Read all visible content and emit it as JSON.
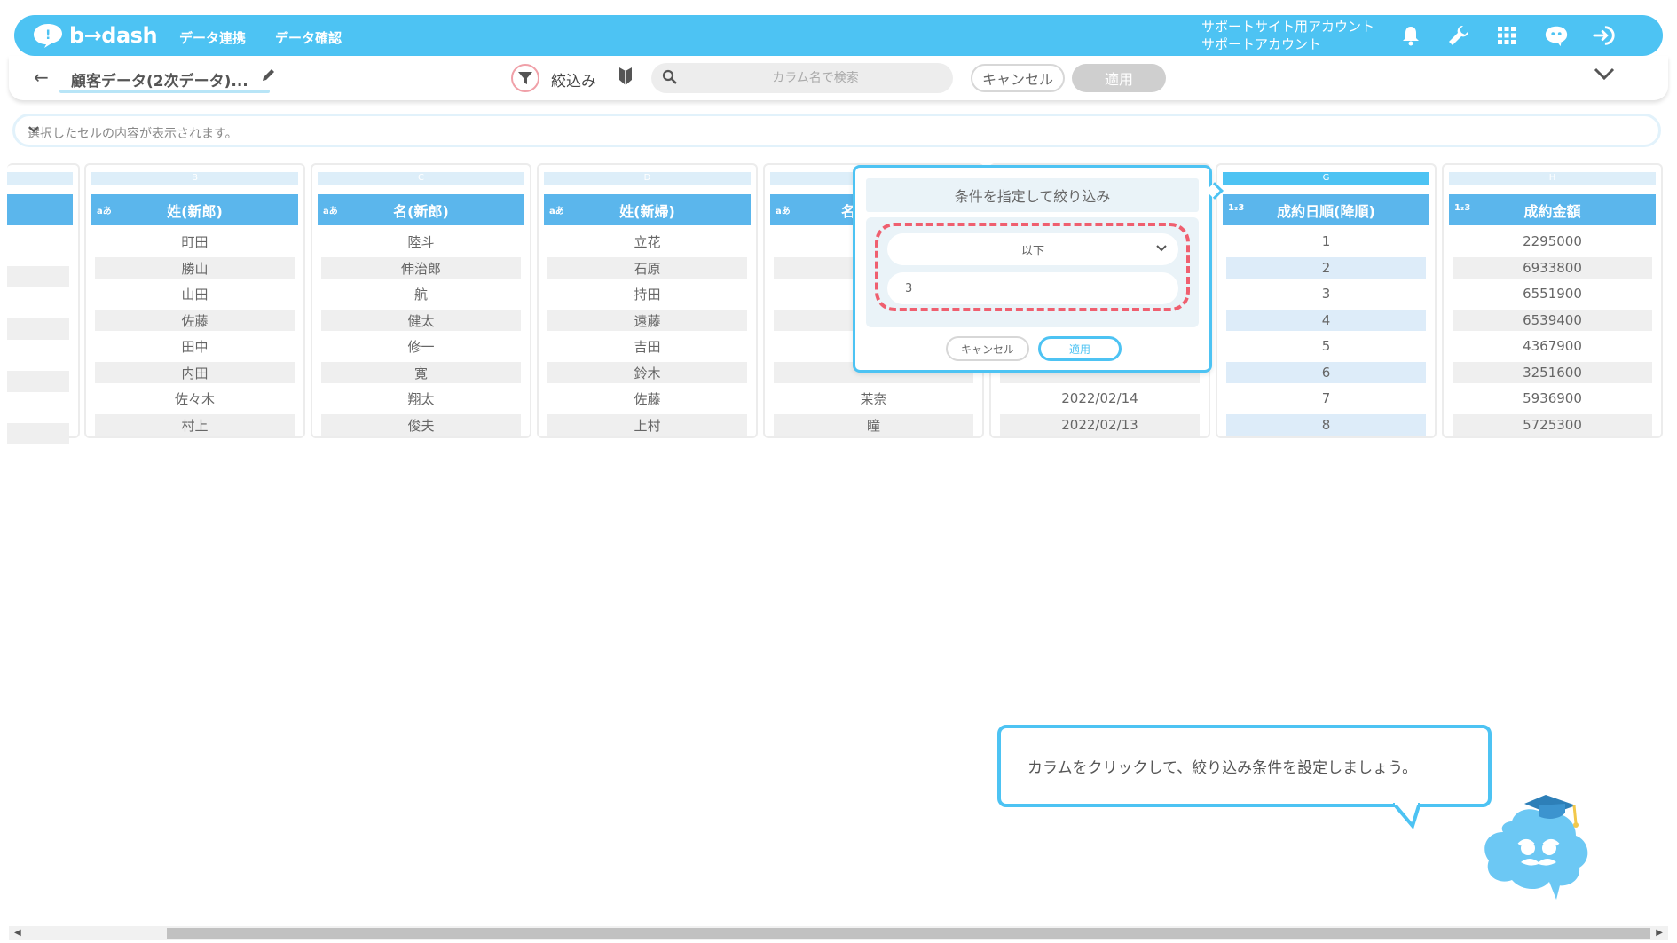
{
  "app": {
    "logo_text": "b→dash"
  },
  "nav": {
    "link1": "データ連携",
    "link2": "データ確認"
  },
  "account": {
    "line1": "サポートサイト用アカウント",
    "line2": "サポートアカウント"
  },
  "toolbar": {
    "table_name": "顧客データ(2次データ)...",
    "filter_label": "絞込み",
    "search_placeholder": "カラム名で検索",
    "cancel_label": "キャンセル",
    "apply_label": "適用"
  },
  "cellbar": {
    "placeholder": "選択したセルの内容が表示されます。"
  },
  "columns": {
    "B": {
      "letter": "B",
      "type": "aあ",
      "header": "姓(新郎)",
      "values": [
        "町田",
        "勝山",
        "山田",
        "佐藤",
        "田中",
        "内田",
        "佐々木",
        "村上"
      ]
    },
    "C": {
      "letter": "C",
      "type": "aあ",
      "header": "名(新郎)",
      "values": [
        "陸斗",
        "伸治郎",
        "航",
        "健太",
        "修一",
        "寛",
        "翔太",
        "俊夫"
      ]
    },
    "D": {
      "letter": "D",
      "type": "aあ",
      "header": "姓(新婦)",
      "values": [
        "立花",
        "石原",
        "持田",
        "遠藤",
        "吉田",
        "鈴木",
        "佐藤",
        "上村"
      ]
    },
    "E": {
      "type": "aあ",
      "header": "名",
      "values": [
        "茉奈",
        "瞳"
      ]
    },
    "F": {
      "values": [
        "2022/02/14",
        "2022/02/13"
      ]
    },
    "G": {
      "letter": "G",
      "type": "1₂3",
      "header": "成約日順(降順)",
      "values": [
        "1",
        "2",
        "3",
        "4",
        "5",
        "6",
        "7",
        "8"
      ]
    },
    "H": {
      "letter": "H",
      "type": "1₂3",
      "header": "成約金額",
      "values": [
        "2295000",
        "6933800",
        "6551900",
        "6539400",
        "4367900",
        "3251600",
        "5936900",
        "5725300"
      ]
    }
  },
  "popup": {
    "title": "条件を指定して絞り込み",
    "operator": "以下",
    "value": "3",
    "cancel_label": "キャンセル",
    "apply_label": "適用"
  },
  "guide": {
    "text": "カラムをクリックして、絞り込み条件を設定しましょう。"
  },
  "colors": {
    "brand": "#4dc3f3",
    "header": "#5bb6ec",
    "highlight": "#ef5f6f"
  }
}
